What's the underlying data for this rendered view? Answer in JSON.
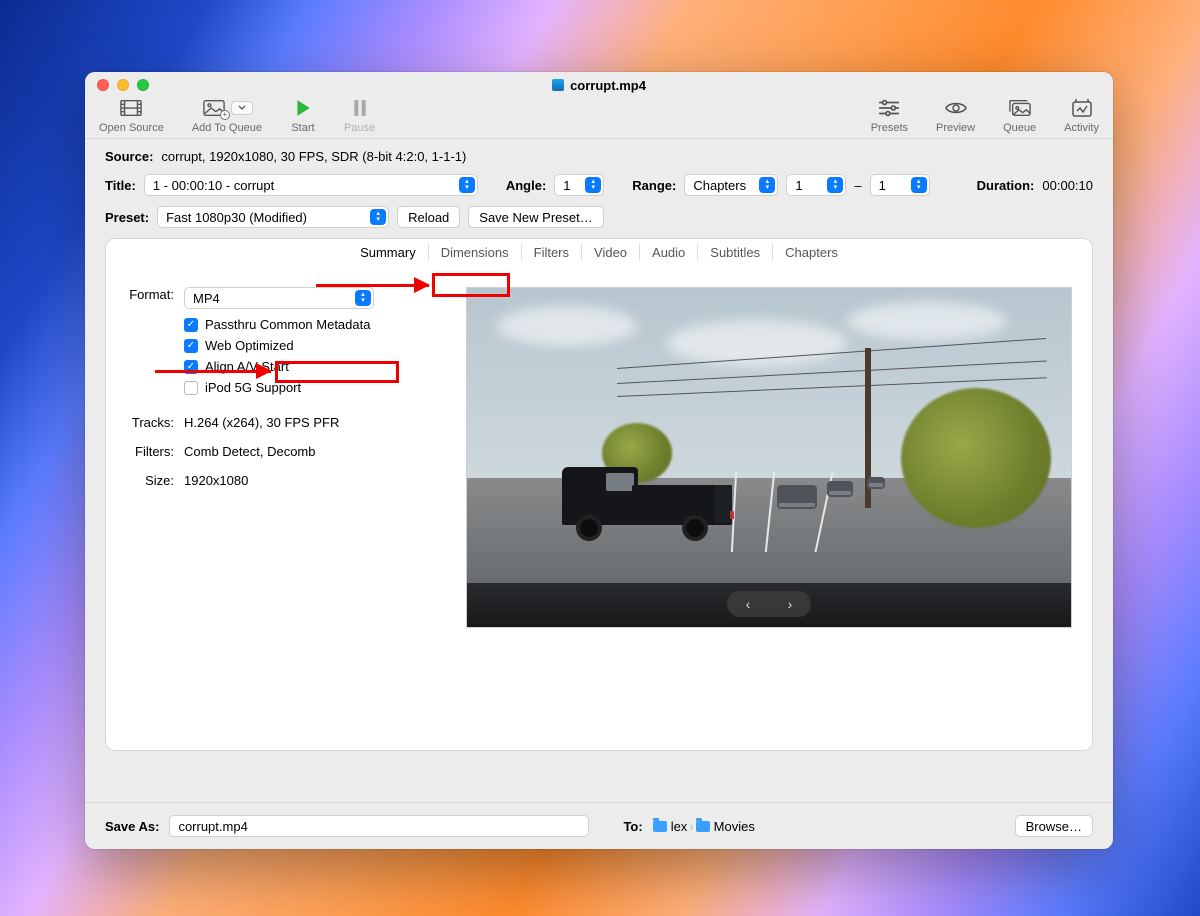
{
  "window": {
    "title": "corrupt.mp4"
  },
  "toolbar": {
    "open_source": "Open Source",
    "add_to_queue": "Add To Queue",
    "start": "Start",
    "pause": "Pause",
    "presets": "Presets",
    "preview": "Preview",
    "queue": "Queue",
    "activity": "Activity"
  },
  "source": {
    "label": "Source:",
    "value": "corrupt, 1920x1080, 30 FPS, SDR (8-bit 4:2:0, 1-1-1)"
  },
  "title_row": {
    "label": "Title:",
    "selected": "1 - 00:00:10 - corrupt",
    "angle_label": "Angle:",
    "angle_value": "1",
    "range_label": "Range:",
    "range_type": "Chapters",
    "range_from": "1",
    "range_dash": "–",
    "range_to": "1",
    "duration_label": "Duration:",
    "duration_value": "00:00:10"
  },
  "preset_row": {
    "label": "Preset:",
    "selected": "Fast 1080p30 (Modified)",
    "reload": "Reload",
    "save_new": "Save New Preset…"
  },
  "tabs": {
    "summary": "Summary",
    "dimensions": "Dimensions",
    "filters": "Filters",
    "video": "Video",
    "audio": "Audio",
    "subtitles": "Subtitles",
    "chapters": "Chapters"
  },
  "summary": {
    "format_label": "Format:",
    "format_value": "MP4",
    "passthru": "Passthru Common Metadata",
    "web_opt": "Web Optimized",
    "align_av": "Align A/V Start",
    "ipod": "iPod 5G Support",
    "tracks_label": "Tracks:",
    "tracks_value": "H.264 (x264), 30 FPS PFR",
    "filters_label": "Filters:",
    "filters_value": "Comb Detect, Decomb",
    "size_label": "Size:",
    "size_value": "1920x1080"
  },
  "preview_nav": {
    "prev": "‹",
    "next": "›"
  },
  "save": {
    "label": "Save As:",
    "filename": "corrupt.mp4",
    "to_label": "To:",
    "path1": "lex",
    "path2": "Movies",
    "browse": "Browse…"
  }
}
